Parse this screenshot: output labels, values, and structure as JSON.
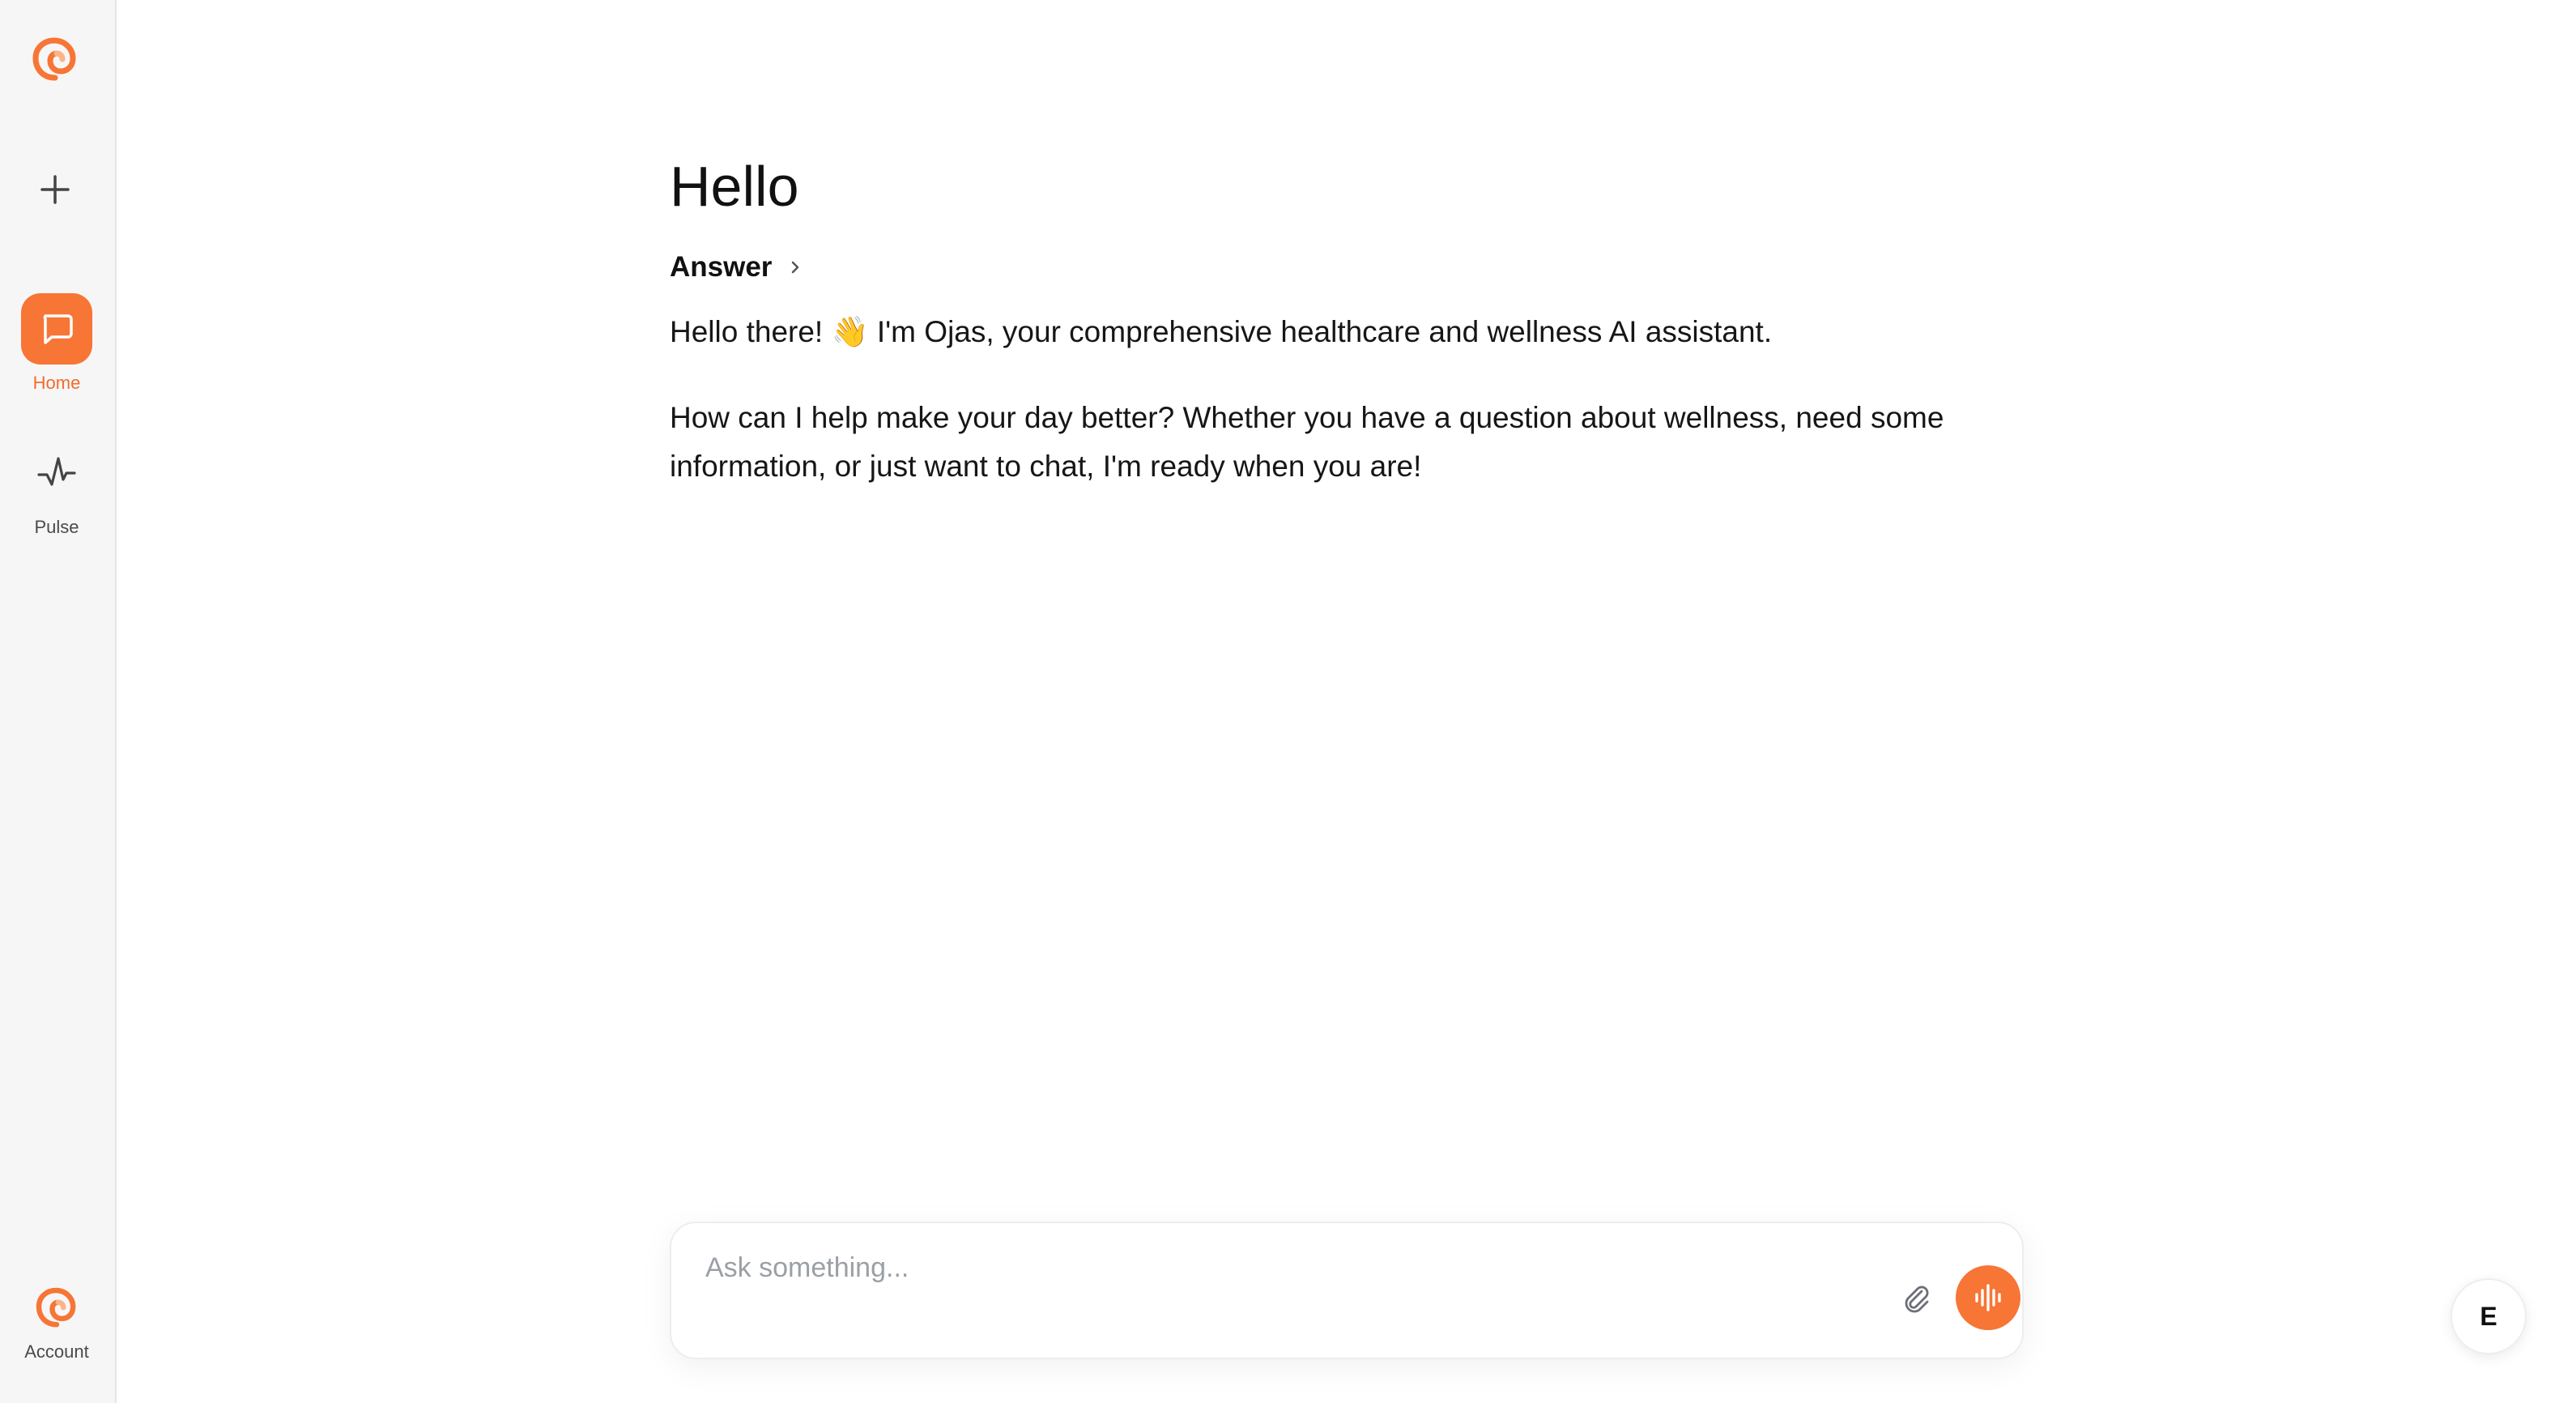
{
  "sidebar": {
    "logo_icon": "ojas-logo-icon",
    "new_chat_icon": "plus-icon",
    "items": [
      {
        "label": "Home",
        "icon": "chat-bubble-icon",
        "active": true
      },
      {
        "label": "Pulse",
        "icon": "activity-pulse-icon",
        "active": false
      }
    ],
    "account": {
      "label": "Account",
      "icon": "ojas-logo-icon"
    }
  },
  "main": {
    "title": "Hello",
    "answer_label": "Answer",
    "answer_icon": "chevron-right-icon",
    "paragraphs": [
      "Hello there! 👋 I'm Ojas, your comprehensive healthcare and wellness AI assistant.",
      "How can I help make your day better? Whether you have a question about wellness, need some information, or just want to chat, I'm ready when you are!"
    ]
  },
  "composer": {
    "placeholder": "Ask something...",
    "value": "",
    "attach_icon": "paperclip-icon",
    "voice_icon": "audio-waveform-icon"
  },
  "user": {
    "initial": "E"
  },
  "colors": {
    "accent": "#f77535",
    "sidebar_bg": "#f6f6f6",
    "text": "#111111",
    "muted": "#4a4a4a",
    "placeholder": "#9aa0a6"
  }
}
